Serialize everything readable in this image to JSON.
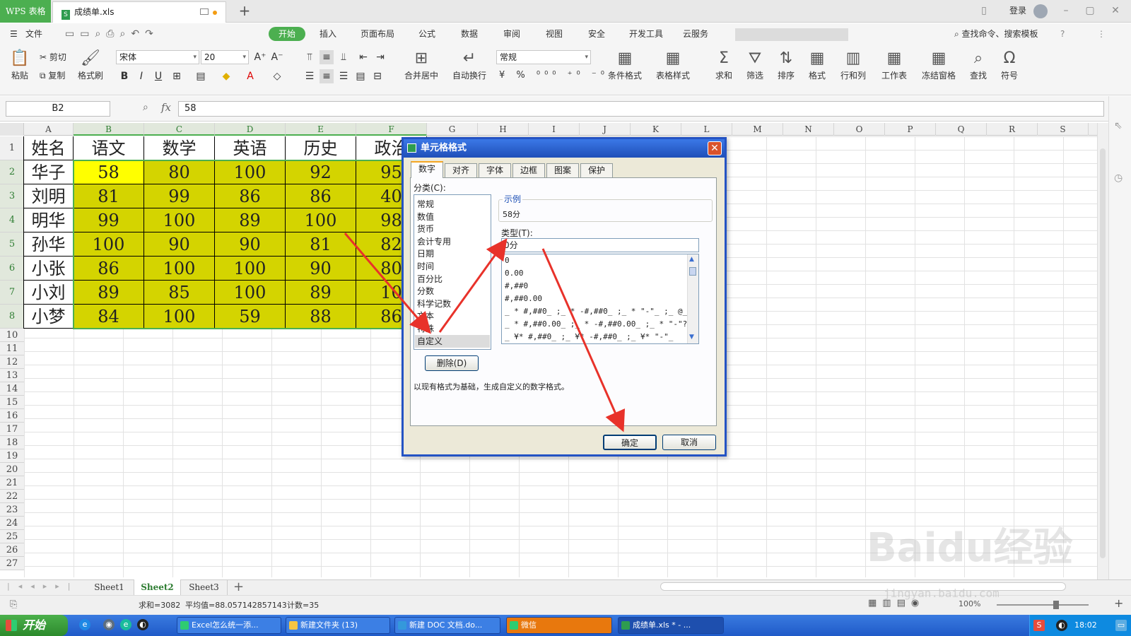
{
  "titlebar": {
    "app_name": "WPS 表格",
    "doc_tab": "成绩单.xls",
    "new_tab": "+",
    "login": "登录"
  },
  "menu": {
    "file": "文件",
    "tabs": [
      "开始",
      "插入",
      "页面布局",
      "公式",
      "数据",
      "审阅",
      "视图",
      "安全",
      "开发工具",
      "云服务"
    ],
    "search": "查找命令、搜索模板"
  },
  "ribbon": {
    "paste": "粘贴",
    "cut": "剪切",
    "copy": "复制",
    "format_painter": "格式刷",
    "font_name": "宋体",
    "font_size": "20",
    "merge_center": "合并居中",
    "wrap_text": "自动换行",
    "number_format": "常规",
    "conditional_format": "条件格式",
    "table_style": "表格样式",
    "sum": "求和",
    "filter": "筛选",
    "sort": "排序",
    "format": "格式",
    "rows_cols": "行和列",
    "worksheet": "工作表",
    "freeze": "冻结窗格",
    "find": "查找",
    "symbol": "符号"
  },
  "formula_bar": {
    "cell_ref": "B2",
    "fx": "fx",
    "value": "58"
  },
  "columns": [
    "A",
    "B",
    "C",
    "D",
    "E",
    "F",
    "G",
    "H",
    "I",
    "J",
    "K",
    "L",
    "M",
    "N",
    "O",
    "P",
    "Q",
    "R",
    "S"
  ],
  "rows": [
    "1",
    "2",
    "3",
    "4",
    "5",
    "6",
    "7",
    "8",
    "10",
    "11",
    "12",
    "13",
    "14",
    "15",
    "16",
    "17",
    "18",
    "19",
    "20",
    "21",
    "22",
    "23",
    "24",
    "25",
    "26",
    "27",
    "28"
  ],
  "table": {
    "headers": [
      "姓名",
      "语文",
      "数学",
      "英语",
      "历史",
      "政治"
    ],
    "rows": [
      [
        "华子",
        "58",
        "80",
        "100",
        "92",
        "95"
      ],
      [
        "刘明",
        "81",
        "99",
        "86",
        "86",
        "40"
      ],
      [
        "明华",
        "99",
        "100",
        "89",
        "100",
        "98"
      ],
      [
        "孙华",
        "100",
        "90",
        "90",
        "81",
        "82"
      ],
      [
        "小张",
        "86",
        "100",
        "100",
        "90",
        "80"
      ],
      [
        "小刘",
        "89",
        "85",
        "100",
        "89",
        "10"
      ],
      [
        "小梦",
        "84",
        "100",
        "59",
        "88",
        "86"
      ]
    ]
  },
  "sheets": [
    "Sheet1",
    "Sheet2",
    "Sheet3"
  ],
  "status": {
    "sum": "求和=3082",
    "average": "平均值=88.057142857143",
    "count": "计数=35",
    "zoom": "100%"
  },
  "dialog": {
    "title": "单元格格式",
    "tabs": [
      "数字",
      "对齐",
      "字体",
      "边框",
      "图案",
      "保护"
    ],
    "category_label": "分类(C):",
    "categories": [
      "常规",
      "数值",
      "货币",
      "会计专用",
      "日期",
      "时间",
      "百分比",
      "分数",
      "科学记数",
      "文本",
      "特殊",
      "自定义"
    ],
    "sample_label": "示例",
    "sample_value": "58分",
    "type_label": "类型(T):",
    "type_value": "0分",
    "format_list": [
      "0",
      "0.00",
      "#,##0",
      "#,##0.00",
      "_ * #,##0_ ;_ * -#,##0_ ;_ * \"-\"_ ;_ @_",
      "_ * #,##0.00_ ;_ * -#,##0.00_ ;_ * \"-\"??",
      "_ ¥* #,##0_ ;_ ¥* -#,##0_ ;_ ¥* \"-\"_"
    ],
    "delete_button": "删除(D)",
    "description": "以现有格式为基础，生成自定义的数字格式。",
    "ok_button": "确定",
    "cancel_button": "取消"
  },
  "taskbar": {
    "start": "开始",
    "items": [
      "Excel怎么统一添...",
      "新建文件夹 (13)",
      "新建 DOC 文档.do...",
      "微信",
      "成绩单.xls * - ..."
    ],
    "clock": "18:02"
  },
  "watermark": "Baidu经验",
  "watermark_url": "jingyan.baidu.com",
  "colors": {
    "accent": "#4caf50",
    "cell_fill": "#d4d400",
    "active_cell": "#ffff00",
    "arrow": "#e8322a",
    "dialog_title": "#2453c4"
  }
}
